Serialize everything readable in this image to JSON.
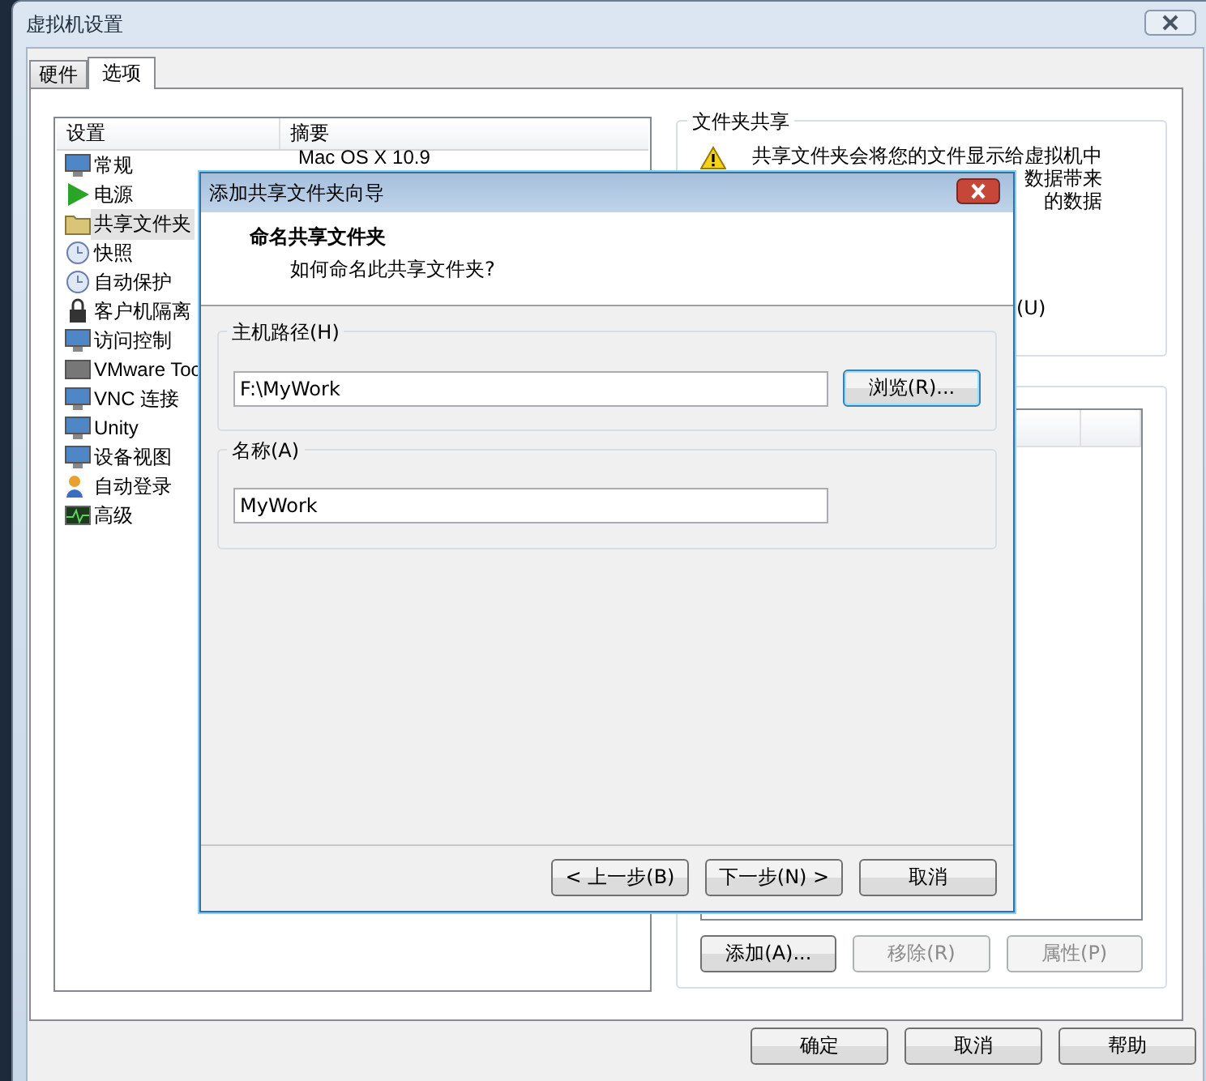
{
  "window": {
    "title": "虚拟机设置"
  },
  "tabs": [
    {
      "label": "硬件",
      "selected": false
    },
    {
      "label": "选项",
      "selected": true
    }
  ],
  "settings_list": {
    "columns": [
      "设置",
      "摘要"
    ],
    "items": [
      {
        "label": "常规",
        "summary": "Mac OS X 10.9",
        "selected": false
      },
      {
        "label": "电源",
        "selected": false
      },
      {
        "label": "共享文件夹",
        "selected": true
      },
      {
        "label": "快照",
        "selected": false
      },
      {
        "label": "自动保护",
        "selected": false
      },
      {
        "label": "客户机隔离",
        "selected": false
      },
      {
        "label": "访问控制",
        "selected": false
      },
      {
        "label": "VMware Too",
        "selected": false
      },
      {
        "label": "VNC 连接",
        "selected": false
      },
      {
        "label": "Unity",
        "selected": false
      },
      {
        "label": "设备视图",
        "selected": false
      },
      {
        "label": "自动登录",
        "selected": false
      },
      {
        "label": "高级",
        "selected": false
      }
    ]
  },
  "folder_sharing": {
    "title": "文件夹共享",
    "warning_lines": [
      "共享文件夹会将您的文件显示给虚拟机中",
      "数据带来",
      "的数据"
    ],
    "option_fragment": "(U)"
  },
  "folder_buttons": [
    {
      "label": "添加(A)...",
      "disabled": false
    },
    {
      "label": "移除(R)",
      "disabled": true
    },
    {
      "label": "属性(P)",
      "disabled": true
    }
  ],
  "buttons": [
    "确定",
    "取消",
    "帮助"
  ],
  "wizard": {
    "title": "添加共享文件夹向导",
    "heading": "命名共享文件夹",
    "subheading": "如何命名此共享文件夹?",
    "host_path": {
      "label": "主机路径(H)",
      "value": "F:\\MyWork",
      "browse": "浏览(R)..."
    },
    "name": {
      "label": "名称(A)",
      "value": "MyWork"
    },
    "buttons": [
      "< 上一步(B)",
      "下一步(N) >",
      "取消"
    ]
  }
}
